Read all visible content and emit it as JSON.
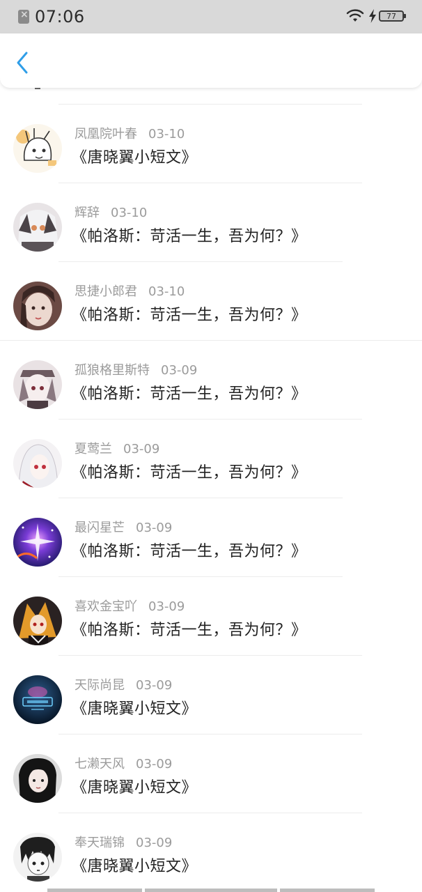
{
  "status_bar": {
    "time": "07:06",
    "battery": "77"
  },
  "nav": {
    "back_icon": "chevron-left-icon",
    "accent_color": "#2f9ee8"
  },
  "items": [
    {
      "user": "凤凰院叶春",
      "date": "03-10",
      "title": "《唐晓翼小短文》"
    },
    {
      "user": "辉辞",
      "date": "03-10",
      "title": "《帕洛斯：苛活一生，吾为何？》"
    },
    {
      "user": "思捷小郎君",
      "date": "03-10",
      "title": "《帕洛斯：苛活一生，吾为何？》"
    },
    {
      "user": "孤狼格里斯特",
      "date": "03-09",
      "title": "《帕洛斯：苛活一生，吾为何？》"
    },
    {
      "user": "夏莺兰",
      "date": "03-09",
      "title": "《帕洛斯：苛活一生，吾为何？》"
    },
    {
      "user": "最闪星芒",
      "date": "03-09",
      "title": "《帕洛斯：苛活一生，吾为何？》"
    },
    {
      "user": "喜欢金宝吖",
      "date": "03-09",
      "title": "《帕洛斯：苛活一生，吾为何？》"
    },
    {
      "user": "天际尚昆",
      "date": "03-09",
      "title": "《唐晓翼小短文》"
    },
    {
      "user": "七濑天风",
      "date": "03-09",
      "title": "《唐晓翼小短文》"
    },
    {
      "user": "奉天瑞锦",
      "date": "03-09",
      "title": "《唐晓翼小短文》"
    }
  ]
}
